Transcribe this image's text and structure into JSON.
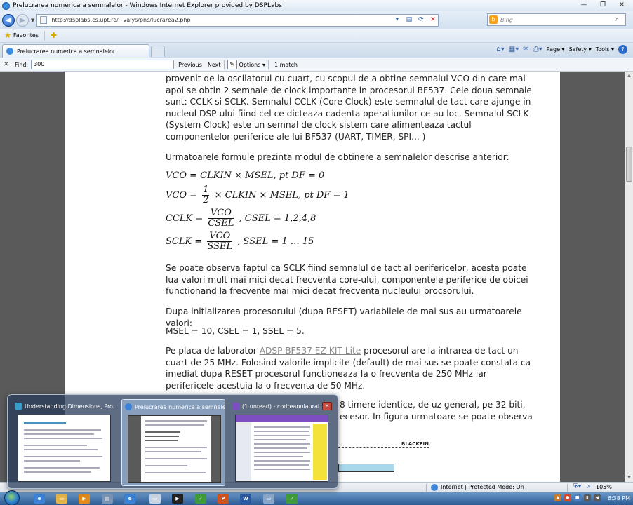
{
  "window": {
    "title": "Prelucrarea numerica a semnalelor - Windows Internet Explorer provided by DSPLabs",
    "controls": [
      "—",
      "❐",
      "✕"
    ]
  },
  "addressbar": {
    "url": "http://dsplabs.cs.upt.ro/~valys/pns/lucrarea2.php",
    "search_placeholder": "Bing"
  },
  "favorites": {
    "label": "Favorites"
  },
  "tab": {
    "label": "Prelucrarea numerica a semnalelor"
  },
  "commandbar": {
    "page": "Page ▾",
    "safety": "Safety ▾",
    "tools": "Tools ▾"
  },
  "findbar": {
    "label": "Find:",
    "value": "300",
    "previous": "Previous",
    "next": "Next",
    "options": "Options ▾",
    "matches": "1 match"
  },
  "content": {
    "para1": "provenit de la oscilatorul cu cuart, cu scopul de a obtine semnalul VCO din care mai apoi se obtin 2 semnale de clock importante in procesorul BF537. Cele doua semnale sunt: CCLK si SCLK. Semnalul CCLK (Core Clock) este semnalul de tact care ajunge in nucleul DSP-ului fiind cel ce dicteaza cadenta operatiunilor ce au loc. Semnalul SCLK (System Clock) este un semnal de clock sistem care alimenteaza tactul componentelor periferice ale lui BF537 (UART, TIMER, SPI... )",
    "para2": "Urmatoarele formule prezinta modul de obtinere a semnalelor descrise anterior:",
    "f1": "VCO =  CLKIN  × MSEL,       pt DF = 0",
    "f2_lhs": "VCO =",
    "f2_num": "1",
    "f2_den": "2",
    "f2_rhs": "× CLKIN × MSEL,       pt DF = 1",
    "f3_lhs": "CCLK =",
    "f3_num": "VCO",
    "f3_den": "CSEL",
    "f3_rhs": ",       CSEL = 1,2,4,8",
    "f4_lhs": "SCLK =",
    "f4_num": "VCO",
    "f4_den": "SSEL",
    "f4_rhs": ",       SSEL = 1 … 15",
    "para3": "Se poate observa faptul ca SCLK fiind semnalul de tact al perifericelor, acesta poate lua valori mult mai mici decat frecventa core-ului, componentele periferice de obicei functionand la frecvente mai mici decat frecventa nucleului procsorului.",
    "para4": "Dupa initializarea procesorului (dupa RESET) variabilele de mai sus au urmatoarele valori:",
    "para5": "MSEL = 10, CSEL = 1, SSEL = 5.",
    "para6_pre": "Pe placa de laborator ",
    "para6_link": "ADSP-BF537 EZ-KIT Lite",
    "para6_post": " procesorul are la intrarea de tact un cuart de 25 MHz. Folosind valorile implicite (default) de mai sus se poate constata ca imediat dupa RESET procesorul functioneaza la o frecventa de 250 MHz iar perifericele acestuia la o frecventa de 50 MHz.",
    "para7": "8 timere identice, de uz general, pe 32 biti, ecesor. In figura urmatoare se poate observa",
    "diagram_label": "BLACKFIN"
  },
  "preview": {
    "items": [
      {
        "title": "Understanding Dimensions, Pro..."
      },
      {
        "title": "Prelucrarea numerica a semnale..."
      },
      {
        "title": "(1 unread) - codreanulaural..."
      }
    ]
  },
  "statusbar": {
    "zone": "Internet | Protected Mode: On",
    "zoom": "105%"
  },
  "taskbar": {
    "clock": "6:38 PM"
  }
}
